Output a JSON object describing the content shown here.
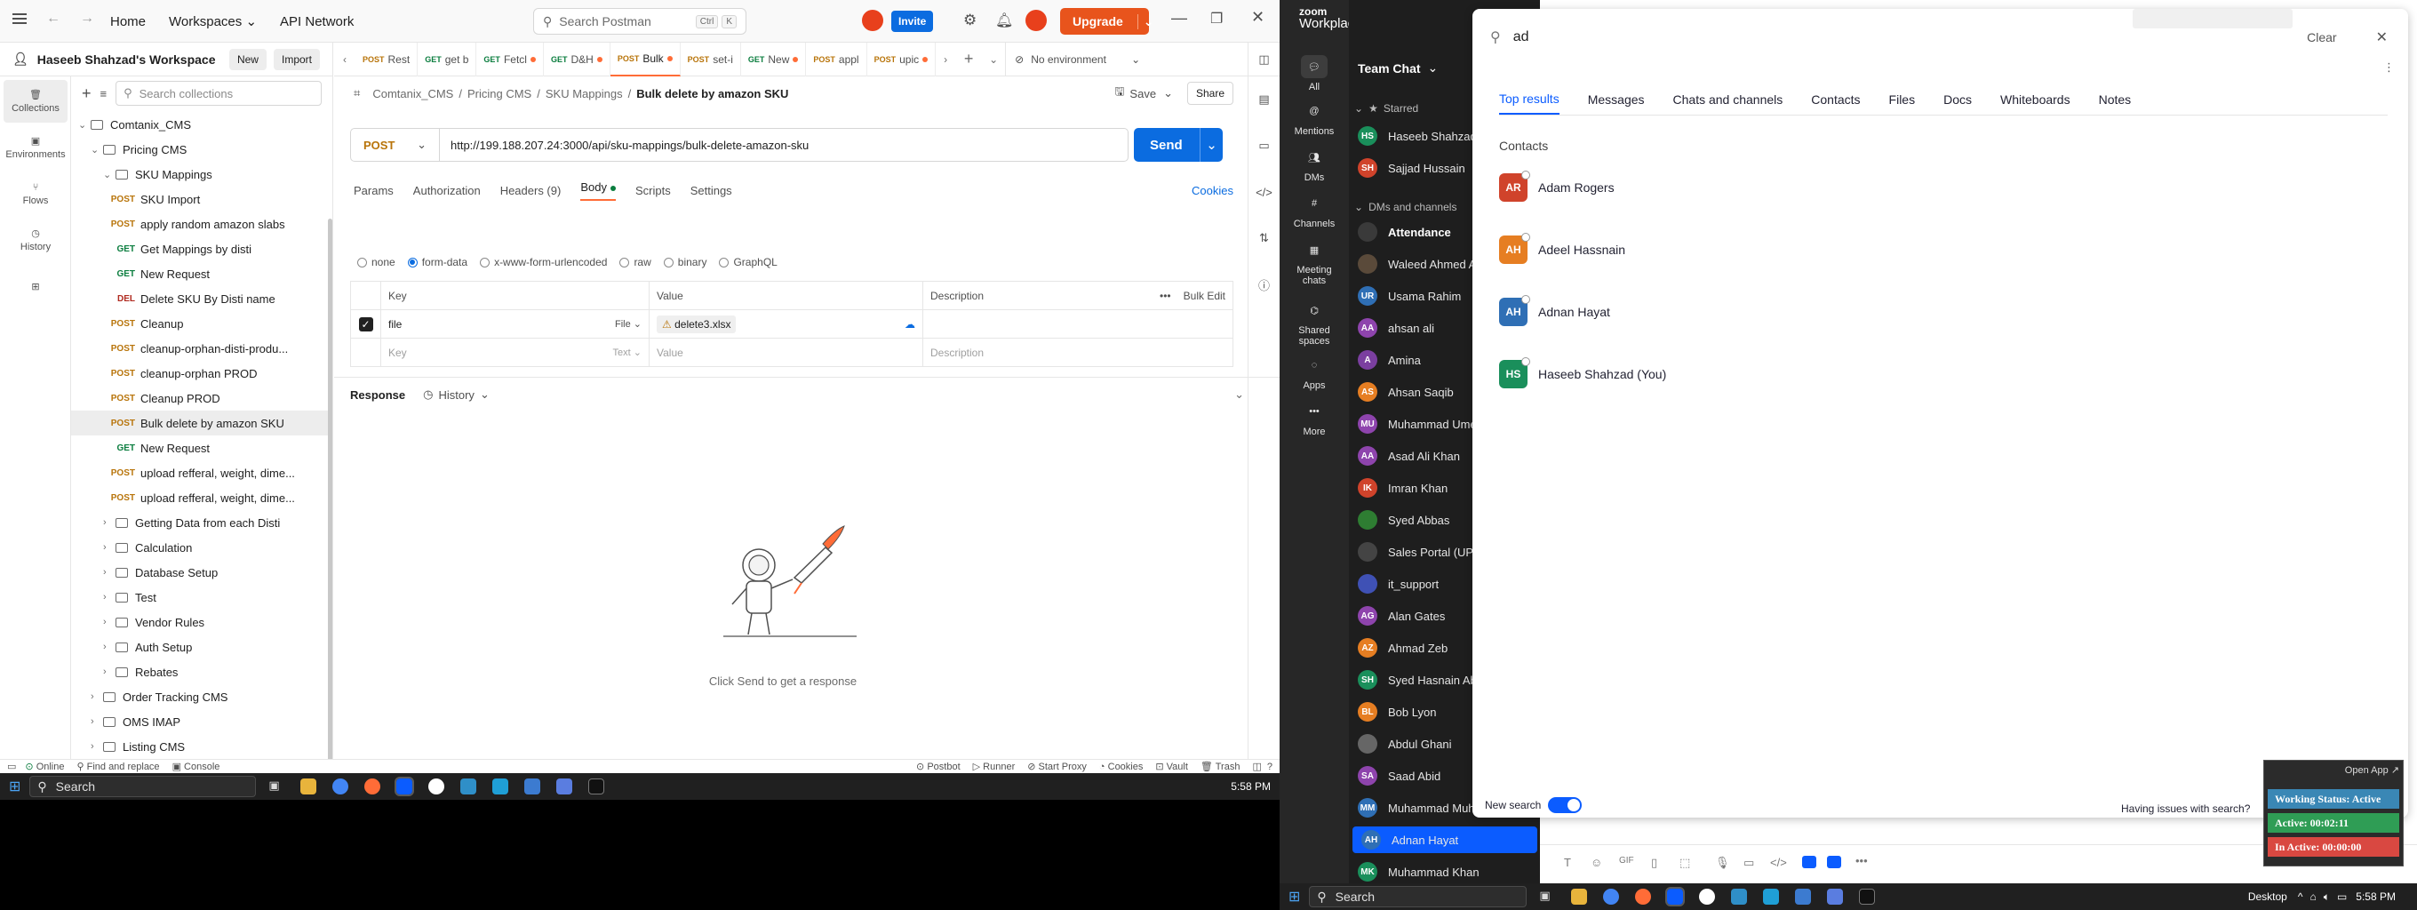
{
  "postman": {
    "nav": {
      "home": "Home",
      "workspaces": "Workspaces",
      "api_network": "API Network"
    },
    "search": {
      "placeholder": "Search Postman",
      "kbd1": "Ctrl",
      "kbd2": "K"
    },
    "invite": "Invite",
    "upgrade": "Upgrade",
    "workspace": {
      "name": "Haseeb Shahzad's Workspace",
      "new": "New",
      "import": "Import"
    },
    "rail": [
      "Collections",
      "Environments",
      "Flows",
      "History"
    ],
    "tree_search_placeholder": "Search collections",
    "tree": [
      {
        "type": "folder",
        "label": "Comtanix_CMS",
        "level": 0,
        "open": true
      },
      {
        "type": "folder",
        "label": "Pricing CMS",
        "level": 1,
        "open": true
      },
      {
        "type": "folder",
        "label": "SKU Mappings",
        "level": 2,
        "open": true
      },
      {
        "type": "req",
        "method": "POST",
        "label": "SKU Import"
      },
      {
        "type": "req",
        "method": "POST",
        "label": "apply random amazon slabs"
      },
      {
        "type": "req",
        "method": "GET",
        "label": "Get Mappings by disti"
      },
      {
        "type": "req",
        "method": "GET",
        "label": "New Request"
      },
      {
        "type": "req",
        "method": "DEL",
        "label": "Delete SKU By Disti name"
      },
      {
        "type": "req",
        "method": "POST",
        "label": "Cleanup"
      },
      {
        "type": "req",
        "method": "POST",
        "label": "cleanup-orphan-disti-produ..."
      },
      {
        "type": "req",
        "method": "POST",
        "label": "cleanup-orphan PROD"
      },
      {
        "type": "req",
        "method": "POST",
        "label": "Cleanup PROD"
      },
      {
        "type": "req",
        "method": "POST",
        "label": "Bulk delete by amazon SKU",
        "selected": true
      },
      {
        "type": "req",
        "method": "GET",
        "label": "New Request"
      },
      {
        "type": "req",
        "method": "POST",
        "label": "upload refferal, weight, dime..."
      },
      {
        "type": "req",
        "method": "POST",
        "label": "upload refferal, weight, dime..."
      },
      {
        "type": "folder",
        "label": "Getting Data from each Disti",
        "level": 2
      },
      {
        "type": "folder",
        "label": "Calculation",
        "level": 2
      },
      {
        "type": "folder",
        "label": "Database Setup",
        "level": 2
      },
      {
        "type": "folder",
        "label": "Test",
        "level": 2
      },
      {
        "type": "folder",
        "label": "Vendor Rules",
        "level": 2
      },
      {
        "type": "folder",
        "label": "Auth Setup",
        "level": 2
      },
      {
        "type": "folder",
        "label": "Rebates",
        "level": 2
      },
      {
        "type": "folder",
        "label": "Order Tracking CMS",
        "level": 1
      },
      {
        "type": "folder",
        "label": "OMS IMAP",
        "level": 1
      },
      {
        "type": "folder",
        "label": "Listing CMS",
        "level": 1
      }
    ],
    "tabs": [
      {
        "method": "POST",
        "label": "Rest"
      },
      {
        "method": "GET",
        "label": "get b"
      },
      {
        "method": "GET",
        "label": "Fetcl",
        "dot": true
      },
      {
        "method": "GET",
        "label": "D&H",
        "dot": true
      },
      {
        "method": "POST",
        "label": "Bulk",
        "dot": true,
        "active": true
      },
      {
        "method": "POST",
        "label": "set-i"
      },
      {
        "method": "GET",
        "label": "New",
        "dot": true
      },
      {
        "method": "POST",
        "label": "appl"
      },
      {
        "method": "POST",
        "label": "upic",
        "dot": true
      }
    ],
    "environment": "No environment",
    "breadcrumb": {
      "a": "Comtanix_CMS",
      "b": "Pricing CMS",
      "c": "SKU Mappings",
      "current": "Bulk delete by amazon SKU"
    },
    "save": "Save",
    "share": "Share",
    "method": "POST",
    "url": "http://199.188.207.24:3000/api/sku-mappings/bulk-delete-amazon-sku",
    "send": "Send",
    "subtabs": {
      "params": "Params",
      "auth": "Authorization",
      "headers": "Headers (9)",
      "body": "Body",
      "scripts": "Scripts",
      "settings": "Settings",
      "cookies": "Cookies"
    },
    "body_types": [
      "none",
      "form-data",
      "x-www-form-urlencoded",
      "raw",
      "binary",
      "GraphQL"
    ],
    "table": {
      "h_key": "Key",
      "h_value": "Value",
      "h_desc": "Description",
      "bulk_edit": "Bulk Edit",
      "row1": {
        "key": "file",
        "type": "File",
        "value": "delete3.xlsx"
      },
      "row2": {
        "key": "Key",
        "type": "Text",
        "value": "Value",
        "desc": "Description"
      }
    },
    "response": {
      "label": "Response",
      "history": "History",
      "empty": "Click Send to get a response"
    },
    "status": {
      "online": "Online",
      "find": "Find and replace",
      "console": "Console",
      "postbot": "Postbot",
      "runner": "Runner",
      "proxy": "Start Proxy",
      "cookies": "Cookies",
      "vault": "Vault",
      "trash": "Trash"
    }
  },
  "taskbar_left": {
    "search": "Search",
    "time": "5:58 PM"
  },
  "taskbar_right": {
    "search": "Search",
    "desktop": "Desktop",
    "time": "5:58 PM"
  },
  "zoom": {
    "logo1": "zoom",
    "logo2": "Workplace",
    "rail": [
      "All",
      "Mentions",
      "DMs",
      "Channels",
      "Meeting chats",
      "Shared spaces",
      "Apps",
      "More"
    ],
    "team_chat": "Team Chat",
    "starred": "Starred",
    "dms_channels": "DMs and channels",
    "contacts_list": [
      {
        "initials": "HS",
        "name": "Haseeb Shahzad",
        "color": "#1a8f5b"
      },
      {
        "initials": "SH",
        "name": "Sajjad Hussain",
        "color": "#d0432b"
      },
      {
        "initials": "",
        "name": "Attendance",
        "color": "#3a3a3a",
        "bold": true
      },
      {
        "initials": "",
        "name": "Waleed Ahmed A",
        "color": "#5a4a3a"
      },
      {
        "initials": "UR",
        "name": "Usama Rahim",
        "color": "#2f6fb5"
      },
      {
        "initials": "AA",
        "name": "ahsan ali",
        "color": "#8e44ad"
      },
      {
        "initials": "A",
        "name": "Amina",
        "color": "#7b3fa0"
      },
      {
        "initials": "AS",
        "name": "Ahsan Saqib",
        "color": "#e67e22"
      },
      {
        "initials": "MU",
        "name": "Muhammad Ume",
        "color": "#8e44ad"
      },
      {
        "initials": "AA",
        "name": "Asad Ali Khan",
        "color": "#8e44ad"
      },
      {
        "initials": "IK",
        "name": "Imran Khan",
        "color": "#d0432b"
      },
      {
        "initials": "",
        "name": "Syed Abbas",
        "color": "#2e7d32"
      },
      {
        "initials": "",
        "name": "Sales Portal (UPD",
        "color": "#444"
      },
      {
        "initials": "",
        "name": "it_support",
        "color": "#3f51b5"
      },
      {
        "initials": "AG",
        "name": "Alan Gates",
        "color": "#8e44ad"
      },
      {
        "initials": "AZ",
        "name": "Ahmad Zeb",
        "color": "#e67e22"
      },
      {
        "initials": "SH",
        "name": "Syed Hasnain Ab",
        "color": "#1a8f5b"
      },
      {
        "initials": "BL",
        "name": "Bob Lyon",
        "color": "#e67e22"
      },
      {
        "initials": "",
        "name": "Abdul Ghani",
        "color": "#666"
      },
      {
        "initials": "SA",
        "name": "Saad Abid",
        "color": "#8e44ad"
      },
      {
        "initials": "MM",
        "name": "Muhammad Muh",
        "color": "#2f6fb5"
      },
      {
        "initials": "AH",
        "name": "Adnan Hayat",
        "color": "#2f6fb5",
        "selected": true
      },
      {
        "initials": "MK",
        "name": "Muhammad Khan",
        "color": "#1a8f5b"
      }
    ],
    "search": {
      "query": "ad",
      "clear": "Clear",
      "tabs": [
        "Top results",
        "Messages",
        "Chats and channels",
        "Contacts",
        "Files",
        "Docs",
        "Whiteboards",
        "Notes"
      ],
      "section": "Contacts",
      "results": [
        {
          "initials": "AR",
          "name": "Adam Rogers",
          "color": "#d0432b"
        },
        {
          "initials": "AH",
          "name": "Adeel Hassnain",
          "color": "#e67e22"
        },
        {
          "initials": "AH",
          "name": "Adnan Hayat",
          "color": "#2f6fb5"
        },
        {
          "initials": "HS",
          "name": "Haseeb Shahzad (You)",
          "color": "#1a8f5b"
        }
      ],
      "new_search": "New search",
      "issue": "Having issues with search?"
    },
    "widget": {
      "open": "Open App",
      "status": "Working Status: Active",
      "active": "Active: 00:02:11",
      "inactive": "In Active: 00:00:00"
    }
  }
}
